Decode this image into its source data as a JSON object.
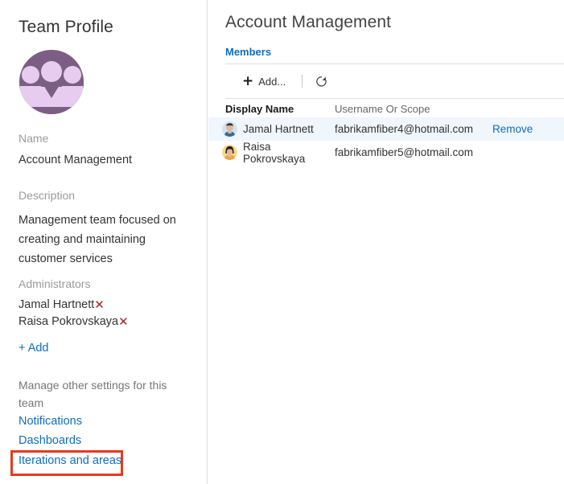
{
  "sidebar": {
    "title": "Team Profile",
    "avatar_icon": "team-group-avatar",
    "name_label": "Name",
    "name_value": "Account Management",
    "description_label": "Description",
    "description_value": "Management team focused on creating and maintaining customer services",
    "administrators_label": "Administrators",
    "administrators": [
      {
        "name": "Jamal Hartnett",
        "remove_icon": "✕"
      },
      {
        "name": "Raisa Pokrovskaya",
        "remove_icon": "✕"
      }
    ],
    "add_admin_label": "+ Add",
    "manage_text": "Manage other settings for this team",
    "links": [
      {
        "label": "Notifications"
      },
      {
        "label": "Dashboards"
      },
      {
        "label": "Iterations and areas"
      }
    ],
    "highlight_color": "#e8381e"
  },
  "main": {
    "page_title": "Account Management",
    "section_title": "Members",
    "toolbar": {
      "add_label": "Add...",
      "add_icon": "plus-icon",
      "refresh_icon": "refresh-icon"
    },
    "table": {
      "columns": [
        "Display Name",
        "Username Or Scope",
        ""
      ],
      "rows": [
        {
          "avatar_icon": "person-avatar-male",
          "display_name": "Jamal Hartnett",
          "username": "fabrikamfiber4@hotmail.com",
          "action": "Remove",
          "selected": true
        },
        {
          "avatar_icon": "person-avatar-female",
          "display_name": "Raisa Pokrovskaya",
          "username": "fabrikamfiber5@hotmail.com",
          "action": "",
          "selected": false
        }
      ]
    }
  },
  "colors": {
    "link": "#106ebe",
    "selected_row": "#eff6fc",
    "avatar_bg": "#7c5e85",
    "avatar_fg": "#e8ccf0",
    "remove_x": "#a4262c"
  }
}
